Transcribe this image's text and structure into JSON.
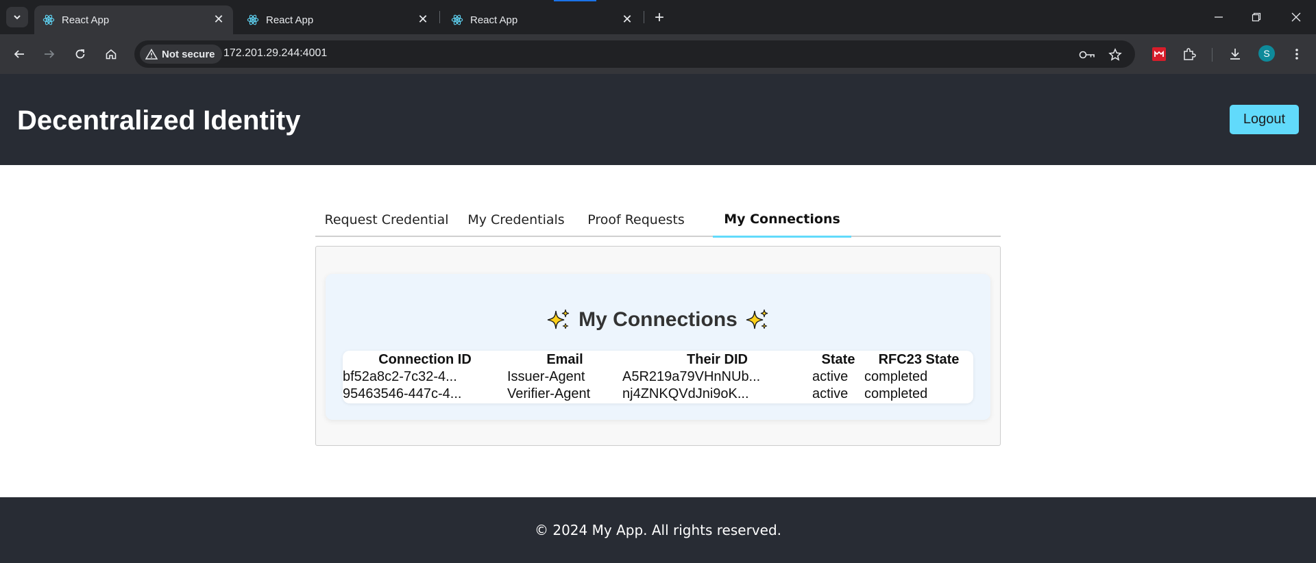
{
  "browser": {
    "tabs": [
      {
        "title": "React App",
        "active": true
      },
      {
        "title": "React App",
        "active": false
      },
      {
        "title": "React App",
        "active": false
      }
    ],
    "security_label": "Not secure",
    "url": "172.201.29.244:4001",
    "profile_initial": "S"
  },
  "header": {
    "title": "Decentralized Identity",
    "logout_label": "Logout"
  },
  "nav": {
    "tabs": [
      {
        "label": "Request Credential"
      },
      {
        "label": "My Credentials"
      },
      {
        "label": "Proof Requests"
      },
      {
        "label": "My Connections"
      }
    ],
    "selected": "My Connections"
  },
  "connections": {
    "title": "My Connections",
    "columns": [
      "Connection ID",
      "Email",
      "Their DID",
      "State",
      "RFC23 State"
    ],
    "rows": [
      {
        "connection_id": "bf52a8c2-7c32-4...",
        "email": "Issuer-Agent",
        "their_did": "A5R219a79VHnNUb...",
        "state": "active",
        "rfc23_state": "completed"
      },
      {
        "connection_id": "95463546-447c-4...",
        "email": "Verifier-Agent",
        "their_did": "nj4ZNKQVdJni9oK...",
        "state": "active",
        "rfc23_state": "completed"
      }
    ]
  },
  "footer": {
    "text": "© 2024 My App. All rights reserved."
  },
  "colors": {
    "header_bg": "#282c34",
    "accent": "#61dafb",
    "card_bg": "#edf5fd"
  }
}
